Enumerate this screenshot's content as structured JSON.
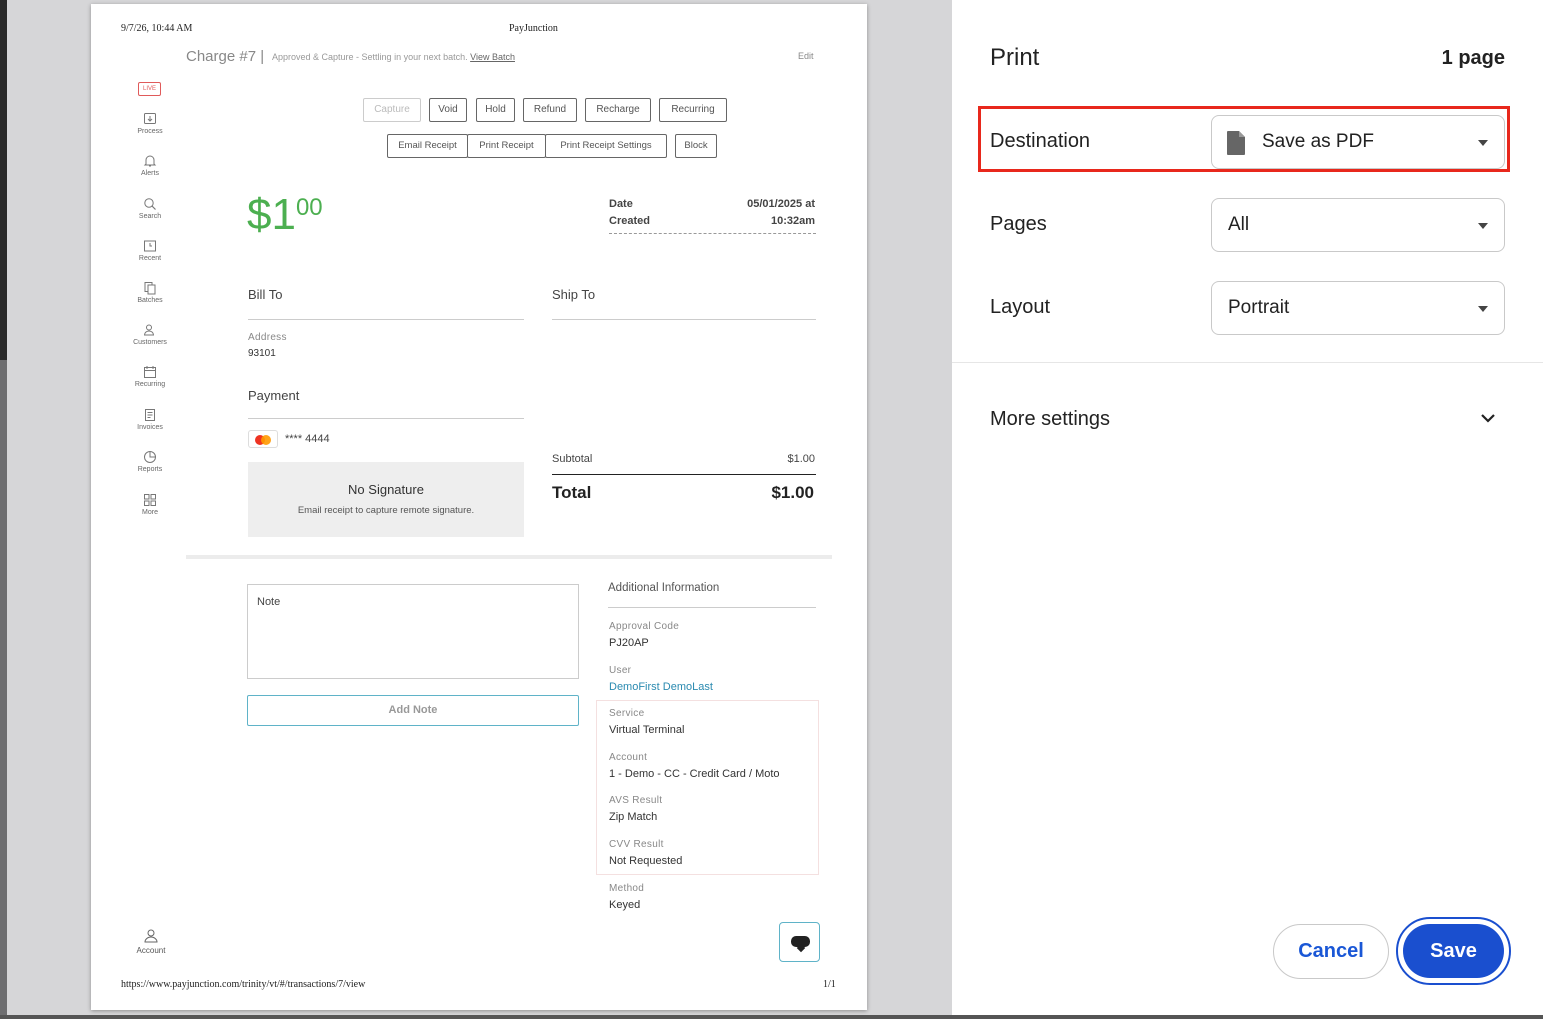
{
  "preview": {
    "header_date": "9/7/26, 10:44 AM",
    "header_title": "PayJunction",
    "footer_url": "https://www.payjunction.com/trinity/vt/#/transactions/7/view",
    "footer_page": "1/1",
    "charge_title": "Charge #7 |",
    "charge_status": "Approved & Capture - Settling in your next batch.",
    "view_batch": "View Batch",
    "edit": "Edit",
    "live_badge": "LIVE",
    "nav": {
      "process": "Process",
      "alerts": "Alerts",
      "search": "Search",
      "recent": "Recent",
      "batches": "Batches",
      "customers": "Customers",
      "recurring": "Recurring",
      "invoices": "Invoices",
      "reports": "Reports",
      "more": "More",
      "account": "Account"
    },
    "actions": {
      "capture": "Capture",
      "void": "Void",
      "hold": "Hold",
      "refund": "Refund",
      "recharge": "Recharge",
      "recurring": "Recurring",
      "email_receipt": "Email Receipt",
      "print_receipt": "Print Receipt",
      "print_receipt_settings": "Print Receipt Settings",
      "block": "Block"
    },
    "amount_main": "$1",
    "amount_cents": "00",
    "date_label_1": "Date",
    "date_label_2": "Created",
    "date_value_1": "05/01/2025 at",
    "date_value_2": "10:32am",
    "bill_to": "Bill To",
    "ship_to": "Ship To",
    "address_label": "Address",
    "address_value": "93101",
    "payment": "Payment",
    "card_number": "**** 4444",
    "no_signature": "No Signature",
    "signature_hint": "Email receipt to capture remote signature.",
    "subtotal_label": "Subtotal",
    "subtotal_value": "$1.00",
    "total_label": "Total",
    "total_value": "$1.00",
    "note_placeholder": "Note",
    "add_note": "Add Note",
    "additional_info": "Additional Information",
    "info": {
      "approval_code_label": "Approval Code",
      "approval_code": "PJ20AP",
      "user_label": "User",
      "user": "DemoFirst DemoLast",
      "service_label": "Service",
      "service": "Virtual Terminal",
      "account_label": "Account",
      "account": "1 - Demo - CC - Credit Card / Moto",
      "avs_label": "AVS Result",
      "avs": "Zip Match",
      "cvv_label": "CVV Result",
      "cvv": "Not Requested",
      "method_label": "Method",
      "method": "Keyed"
    }
  },
  "print_panel": {
    "title": "Print",
    "page_count": "1 page",
    "destination_label": "Destination",
    "destination_value": "Save as PDF",
    "pages_label": "Pages",
    "pages_value": "All",
    "layout_label": "Layout",
    "layout_value": "Portrait",
    "more_settings": "More settings",
    "cancel": "Cancel",
    "save": "Save"
  },
  "colors": {
    "accent_blue": "#1a4fcf",
    "highlight_red": "#e8281c",
    "amount_green": "#4caf50"
  }
}
